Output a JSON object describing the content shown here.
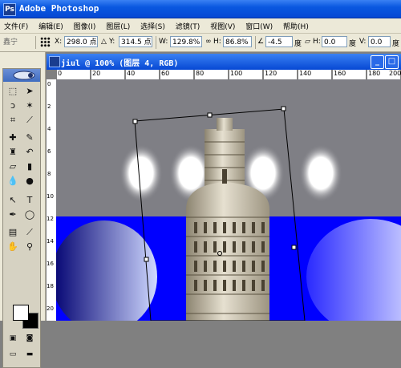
{
  "app": {
    "title": "Adobe Photoshop",
    "icon_label": "Ps"
  },
  "menu": [
    "文件(F)",
    "编辑(E)",
    "图像(I)",
    "图层(L)",
    "选择(S)",
    "滤镜(T)",
    "视图(V)",
    "窗口(W)",
    "帮助(H)"
  ],
  "options": {
    "tool_label": "鑫宁",
    "x_label": "X:",
    "x_value": "298.0 点",
    "y_label": "Y:",
    "y_value": "314.5 点",
    "w_label": "W:",
    "w_value": "129.8%",
    "h_label": "H:",
    "h_value": "86.8%",
    "angle_value": "-4.5",
    "angle_unit": "度",
    "hskew_label": "H:",
    "hskew_value": "0.0",
    "hskew_unit": "度",
    "vskew_label": "V:",
    "vskew_value": "0.0",
    "vskew_unit": "度"
  },
  "document": {
    "title": "jiul @ 100% (图层 4, RGB)",
    "minimize": "_",
    "maximize": "□",
    "ruler_h": [
      "0",
      "20",
      "40",
      "60",
      "80",
      "100",
      "120",
      "140",
      "160",
      "180",
      "200"
    ],
    "ruler_v": [
      "0",
      "2",
      "4",
      "6",
      "8",
      "10",
      "12",
      "14",
      "16",
      "18",
      "20"
    ]
  },
  "colors": {
    "canvas_gray": "#7f7f85",
    "canvas_blue": "#0000ff",
    "xp_blue": "#0a58e0"
  },
  "icons": {
    "tools": [
      "move-icon",
      "marquee-icon",
      "lasso-icon",
      "magic-wand-icon",
      "crop-icon",
      "slice-icon",
      "healing-icon",
      "brush-icon",
      "stamp-icon",
      "history-brush-icon",
      "eraser-icon",
      "gradient-icon",
      "blur-icon",
      "dodge-icon",
      "path-select-icon",
      "type-icon",
      "pen-icon",
      "shape-icon",
      "notes-icon",
      "eyedropper-icon",
      "hand-icon",
      "zoom-icon"
    ]
  }
}
